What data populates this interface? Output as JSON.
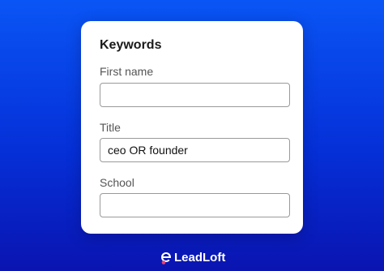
{
  "card": {
    "title": "Keywords",
    "fields": [
      {
        "label": "First name",
        "value": "",
        "placeholder": ""
      },
      {
        "label": "Title",
        "value": "ceo OR founder",
        "placeholder": ""
      },
      {
        "label": "School",
        "value": "",
        "placeholder": ""
      }
    ]
  },
  "brand": {
    "name": "LeadLoft",
    "icon": "leadloft-logo-icon"
  },
  "colors": {
    "background_top": "#0a55f5",
    "background_bottom": "#0a14b0",
    "card": "#ffffff",
    "logo_accent": "#e8407a"
  }
}
